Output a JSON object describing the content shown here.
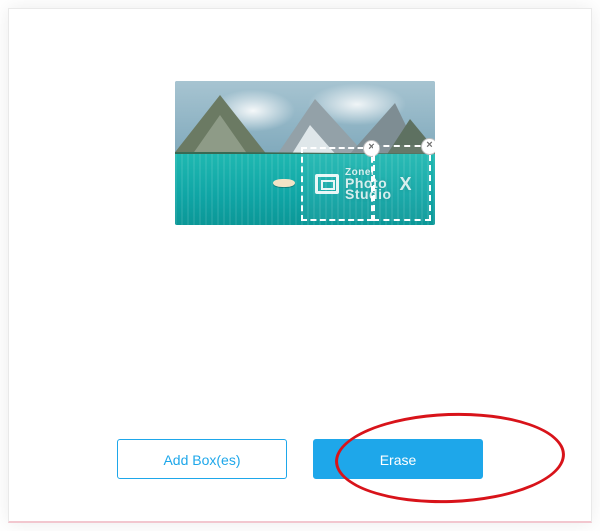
{
  "preview": {
    "watermark": {
      "line1": "Zoner",
      "line2_main": "Photo",
      "line3_main": "Studio",
      "suffix": "X"
    },
    "selection_boxes": [
      {
        "id": "box-1",
        "close_glyph": "×"
      },
      {
        "id": "box-2",
        "close_glyph": "×"
      }
    ]
  },
  "buttons": {
    "add_boxes": "Add Box(es)",
    "erase": "Erase"
  },
  "annotation": {
    "target": "erase-button"
  },
  "colors": {
    "accent": "#1ea7ea",
    "annotation": "#d8131a"
  }
}
